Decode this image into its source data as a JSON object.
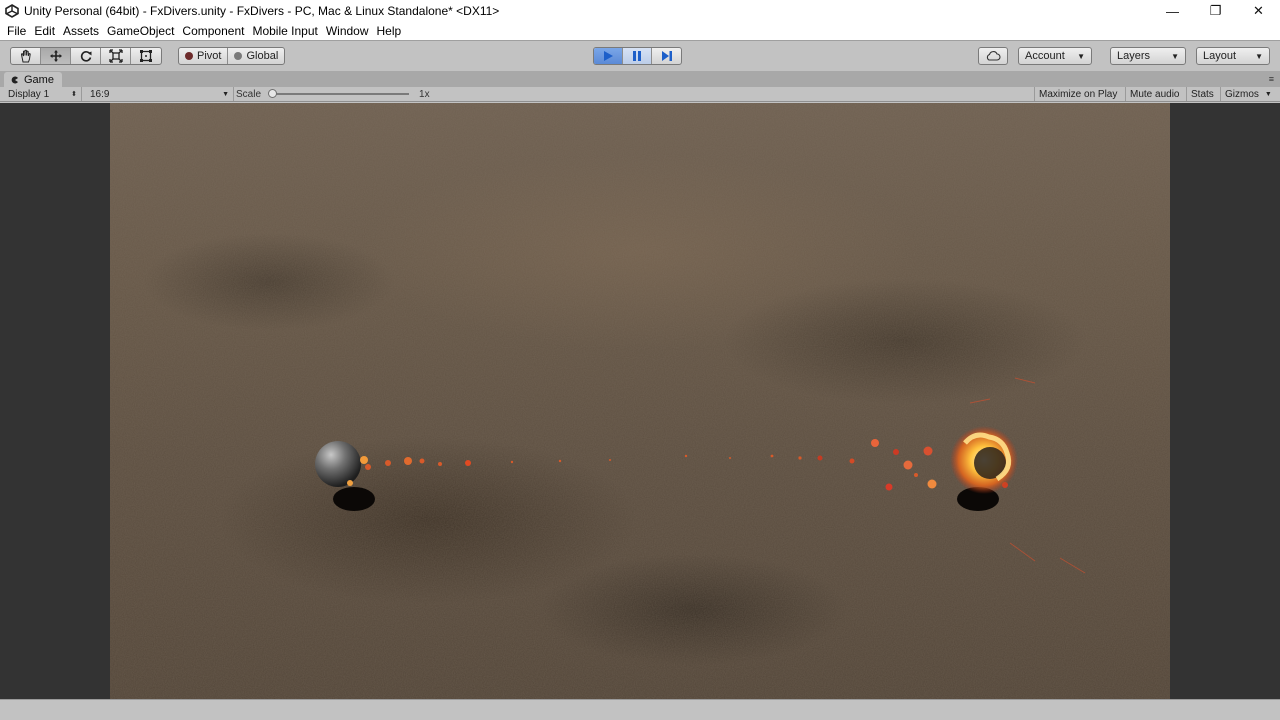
{
  "window": {
    "title": "Unity Personal (64bit) - FxDivers.unity - FxDivers - PC, Mac & Linux Standalone* <DX11>",
    "minimize": "—",
    "restore": "❐",
    "close": "✕"
  },
  "menu": [
    "File",
    "Edit",
    "Assets",
    "GameObject",
    "Component",
    "Mobile Input",
    "Window",
    "Help"
  ],
  "toolbar": {
    "transform_tools": [
      "hand-tool",
      "move-tool",
      "rotate-tool",
      "scale-tool",
      "rect-tool"
    ],
    "active_tool": "move-tool",
    "pivot_label": "Pivot",
    "global_label": "Global",
    "play_state": "playing",
    "account_label": "Account",
    "layers_label": "Layers",
    "layout_label": "Layout",
    "accent_color": "#3c7ddb"
  },
  "game_tab": {
    "label": "Game",
    "display": "Display 1",
    "aspect": "16:9",
    "scale_label": "Scale",
    "scale_value": "1x",
    "maximize_on_play": "Maximize on Play",
    "mute_audio": "Mute audio",
    "stats": "Stats",
    "gizmos": "Gizmos"
  }
}
